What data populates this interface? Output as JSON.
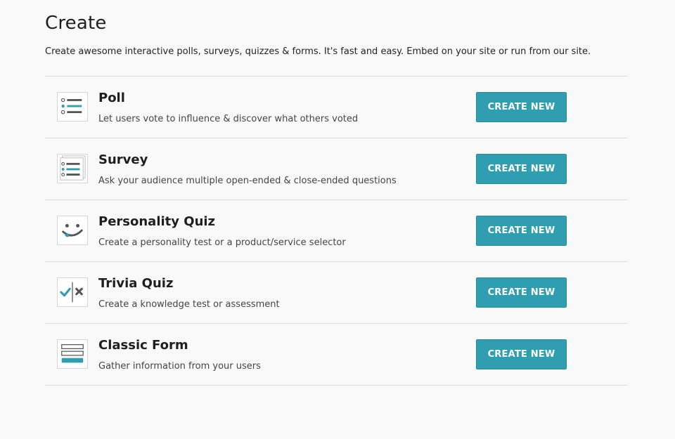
{
  "page": {
    "title": "Create",
    "subtitle": "Create awesome interactive polls, surveys, quizzes & forms. It's fast and easy. Embed on your site or run from our site."
  },
  "items": [
    {
      "name": "poll",
      "icon": "poll-icon",
      "title": "Poll",
      "description": "Let users vote to influence & discover what others voted",
      "button_label": "CREATE NEW"
    },
    {
      "name": "survey",
      "icon": "survey-icon",
      "title": "Survey",
      "description": "Ask your audience multiple open-ended & close-ended questions",
      "button_label": "CREATE NEW"
    },
    {
      "name": "personality-quiz",
      "icon": "smiley-face-icon",
      "title": "Personality Quiz",
      "description": "Create a personality test or a product/service selector",
      "button_label": "CREATE NEW"
    },
    {
      "name": "trivia-quiz",
      "icon": "check-cross-icon",
      "title": "Trivia Quiz",
      "description": "Create a knowledge test or assessment",
      "button_label": "CREATE NEW"
    },
    {
      "name": "classic-form",
      "icon": "form-fields-icon",
      "title": "Classic Form",
      "description": "Gather information from your users",
      "button_label": "CREATE NEW"
    }
  ],
  "colors": {
    "accent": "#2e9eb0",
    "icon_dark": "#555555",
    "background": "#f9f9f9",
    "divider": "#dedede"
  }
}
